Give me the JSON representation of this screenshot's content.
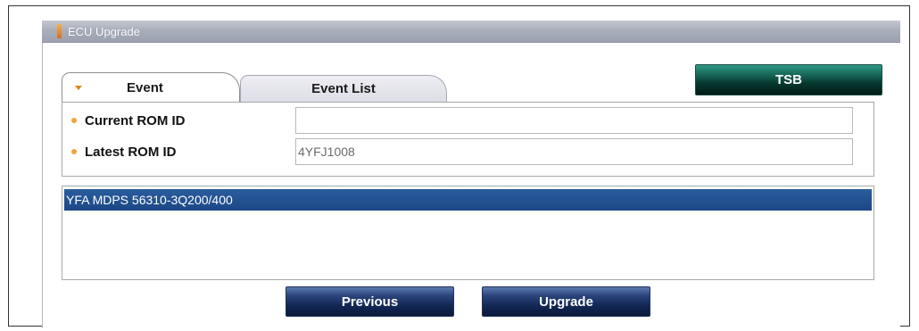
{
  "window": {
    "title": "ECU Upgrade",
    "icon": "window-icon"
  },
  "tabs": [
    {
      "label": "Event",
      "active": true
    },
    {
      "label": "Event List",
      "active": false
    }
  ],
  "tsb_button": {
    "label": "TSB"
  },
  "rom": {
    "current_label": "Current ROM ID",
    "current_value": "",
    "latest_label": "Latest ROM ID",
    "latest_value": "4YFJ1008"
  },
  "event_list": {
    "items": [
      "YFA MDPS  56310-3Q200/400"
    ],
    "selected_index": 0
  },
  "buttons": {
    "previous": "Previous",
    "upgrade": "Upgrade"
  },
  "colors": {
    "selection": "#1c4785",
    "accent_orange": "#e0801e",
    "tsb_green": "#1a6e5e",
    "button_navy": "#132856"
  }
}
